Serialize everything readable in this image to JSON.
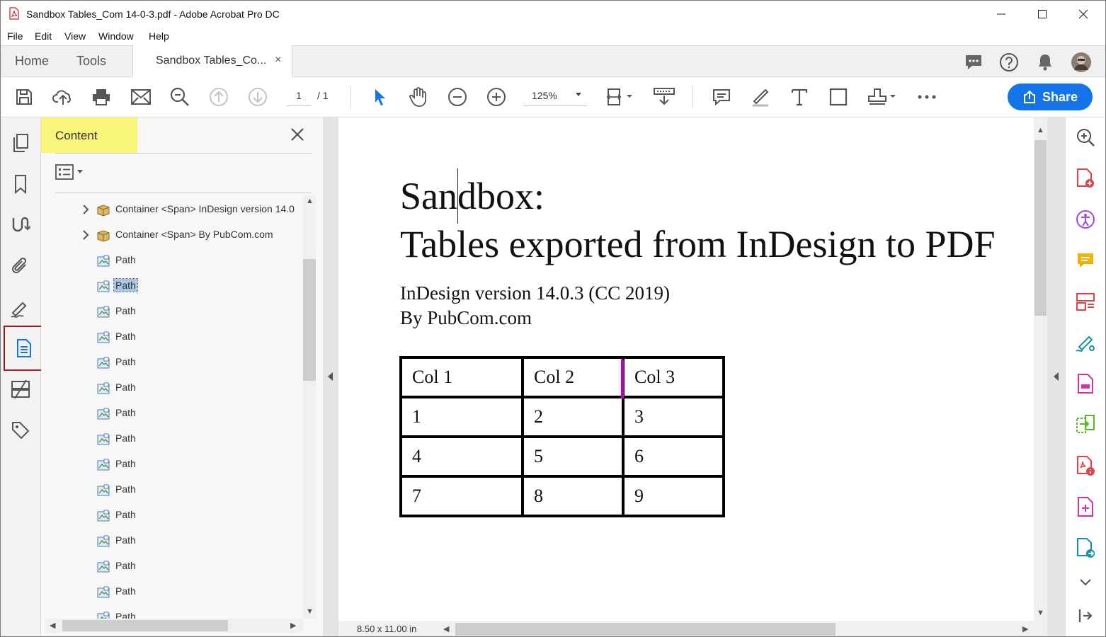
{
  "window": {
    "title": "Sandbox Tables_Com 14-0-3.pdf - Adobe Acrobat Pro DC"
  },
  "menu": [
    "File",
    "Edit",
    "View",
    "Window",
    "Help"
  ],
  "tabs": {
    "home": "Home",
    "tools": "Tools",
    "document": "Sandbox Tables_Co...",
    "close": "×"
  },
  "toolbar": {
    "page_current": "1",
    "page_total": "/ 1",
    "zoom": "125%",
    "share_label": "Share"
  },
  "panel": {
    "title": "Content",
    "items": [
      {
        "type": "container",
        "label": "Container <Span> InDesign version 14.0"
      },
      {
        "type": "container",
        "label": "Container <Span> By PubCom.com"
      },
      {
        "type": "path",
        "label": "Path"
      },
      {
        "type": "path",
        "label": "Path",
        "selected": true
      },
      {
        "type": "path",
        "label": "Path"
      },
      {
        "type": "path",
        "label": "Path"
      },
      {
        "type": "path",
        "label": "Path"
      },
      {
        "type": "path",
        "label": "Path"
      },
      {
        "type": "path",
        "label": "Path"
      },
      {
        "type": "path",
        "label": "Path"
      },
      {
        "type": "path",
        "label": "Path"
      },
      {
        "type": "path",
        "label": "Path"
      },
      {
        "type": "path",
        "label": "Path"
      },
      {
        "type": "path",
        "label": "Path"
      },
      {
        "type": "path",
        "label": "Path"
      },
      {
        "type": "path",
        "label": "Path"
      },
      {
        "type": "path",
        "label": "Path"
      }
    ]
  },
  "document": {
    "title_line1": "Sandbox:",
    "title_line2": "Tables exported from InDesign to PDF",
    "subtitle_line1": "InDesign version 14.0.3 (CC 2019)",
    "subtitle_line2": "By PubCom.com",
    "table": {
      "header": [
        "Col 1",
        "Col 2",
        "Col 3"
      ],
      "rows": [
        [
          "1",
          "2",
          "3"
        ],
        [
          "4",
          "5",
          "6"
        ],
        [
          "7",
          "8",
          "9"
        ]
      ]
    },
    "page_size": "8.50 x 11.00 in"
  },
  "colors": {
    "accent": "#1473e6",
    "panel_header_highlight": "#f7f57a",
    "selection": "#a8c7e6",
    "active_rail_border": "#a01c24"
  }
}
